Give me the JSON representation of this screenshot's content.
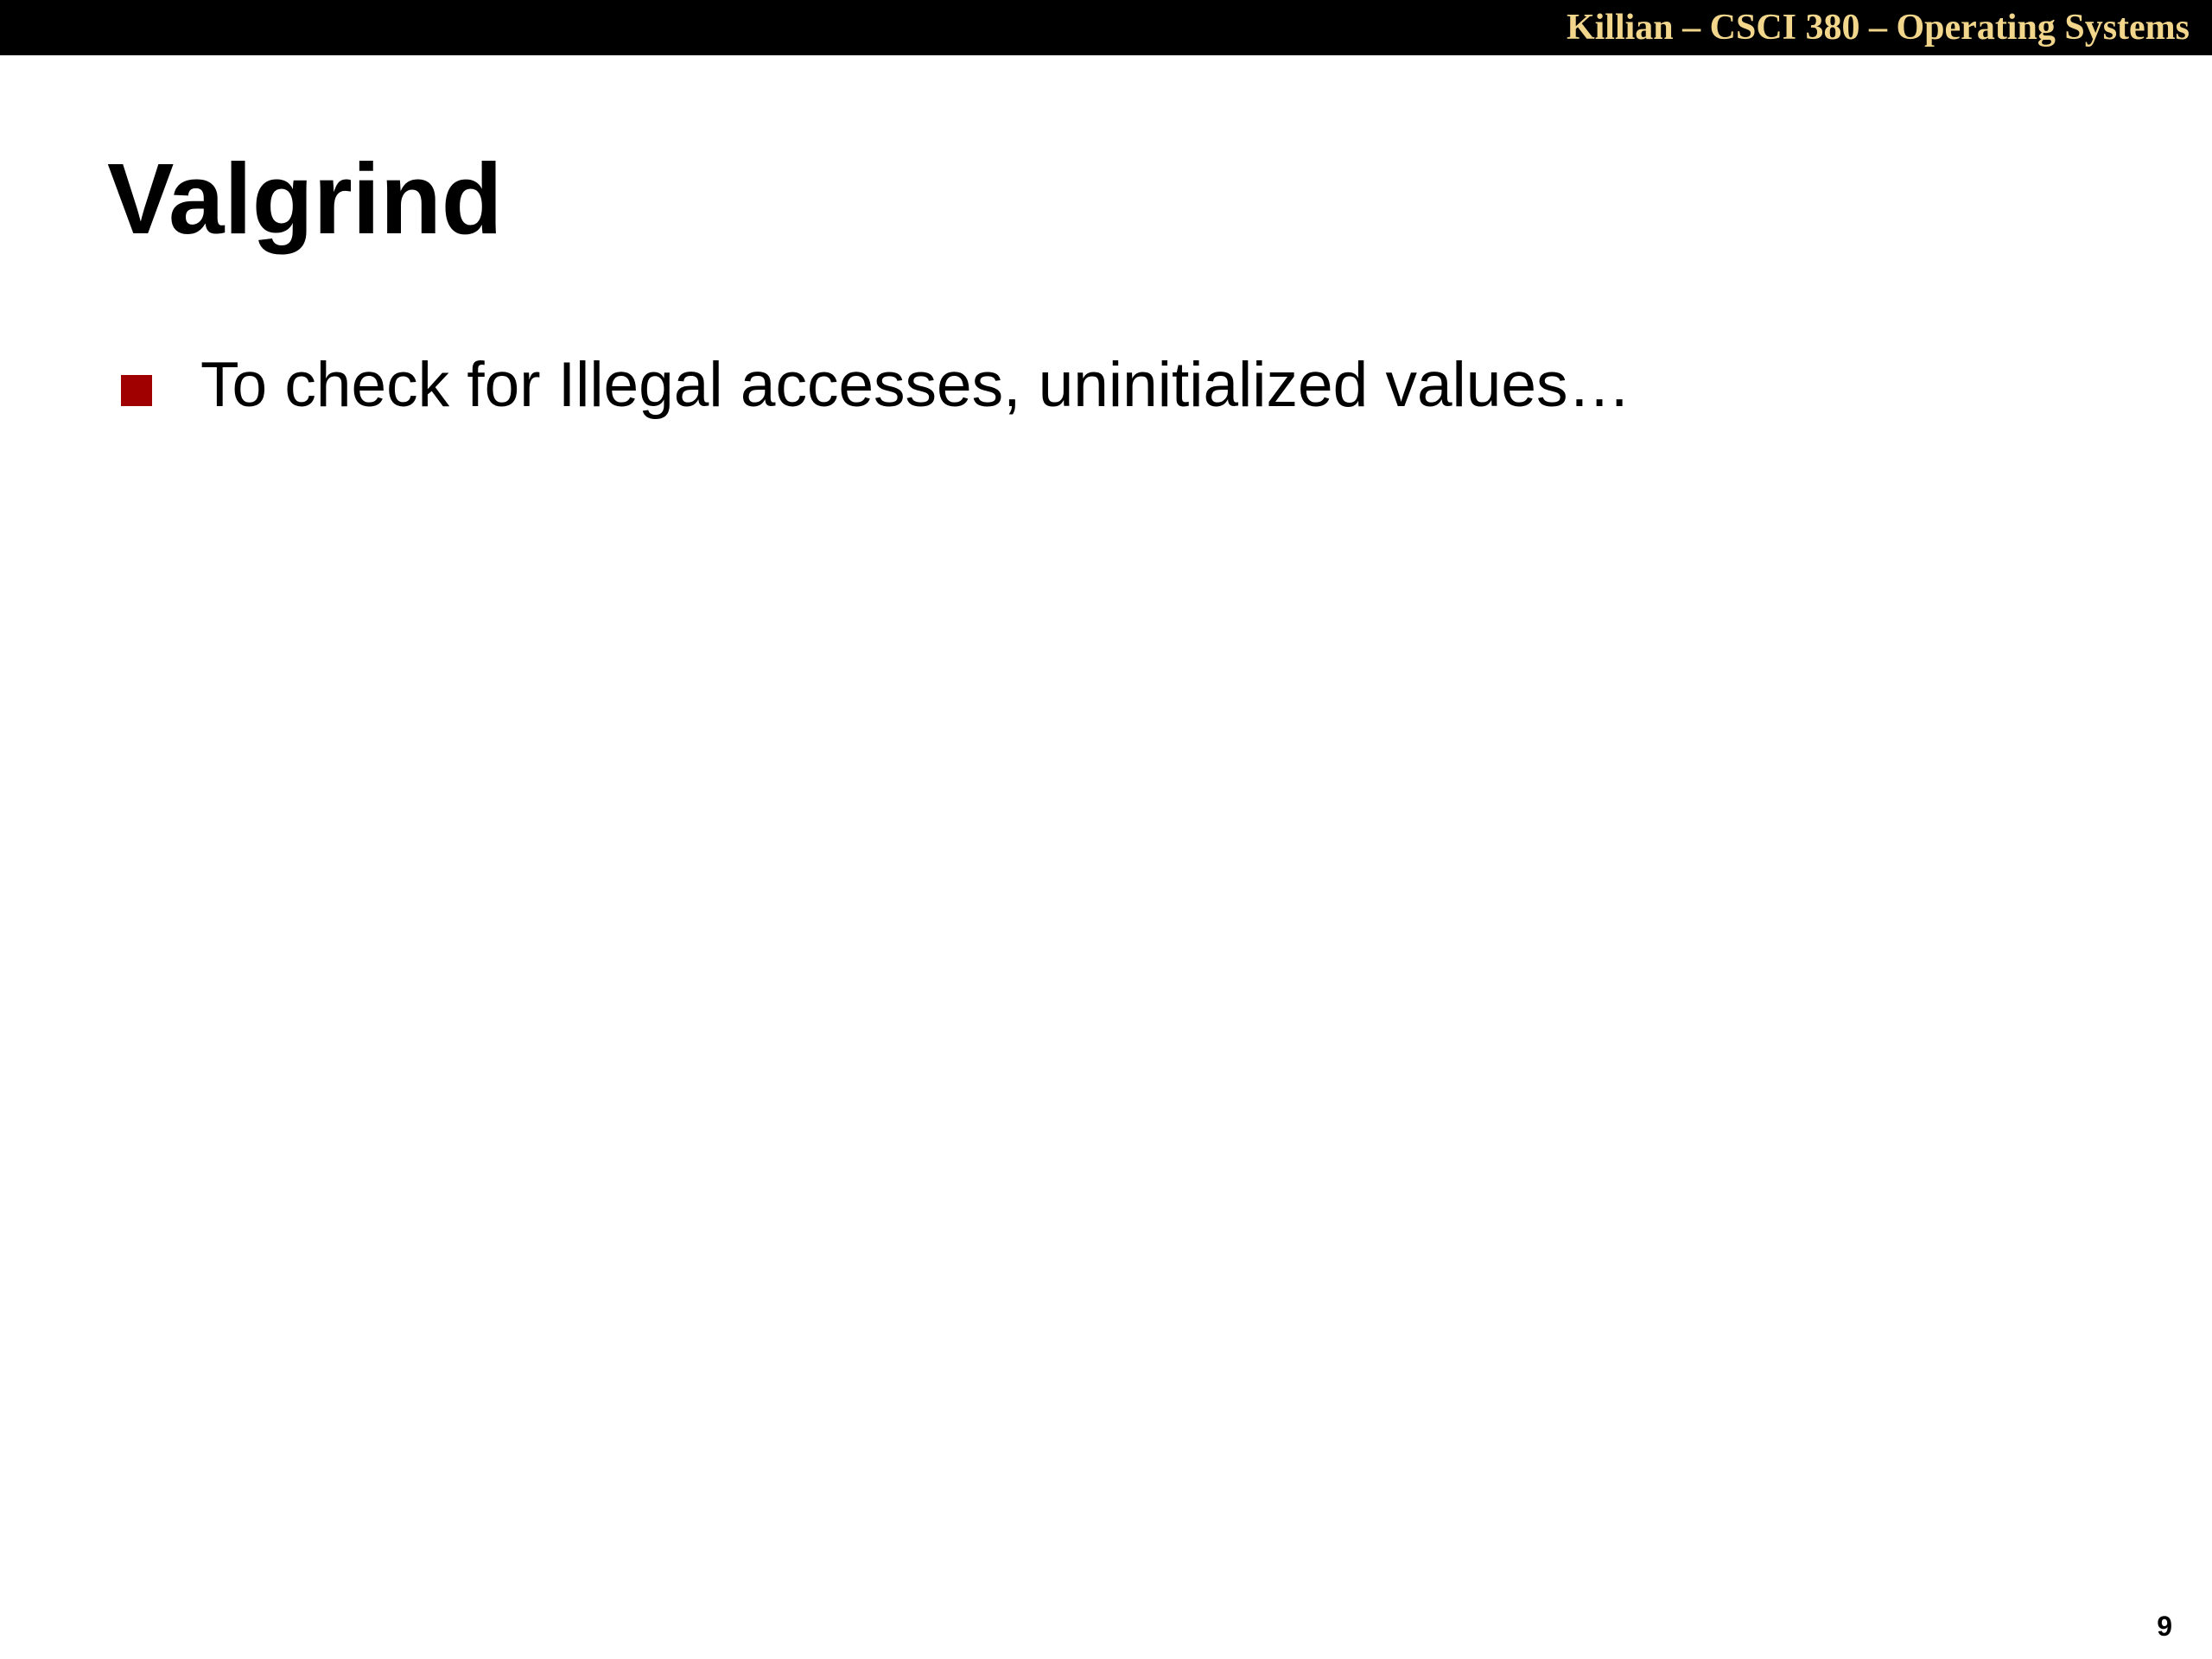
{
  "header": {
    "course_title": "Killian – CSCI 380 – Operating Systems"
  },
  "slide": {
    "title": "Valgrind",
    "bullets": [
      {
        "text": "To check for Illegal accesses, uninitialized values…"
      }
    ],
    "page_number": "9"
  },
  "colors": {
    "header_bar": "#000000",
    "header_text": "#f2d68c",
    "bullet_marker": "#a00000",
    "body_text": "#000000",
    "background": "#ffffff"
  }
}
